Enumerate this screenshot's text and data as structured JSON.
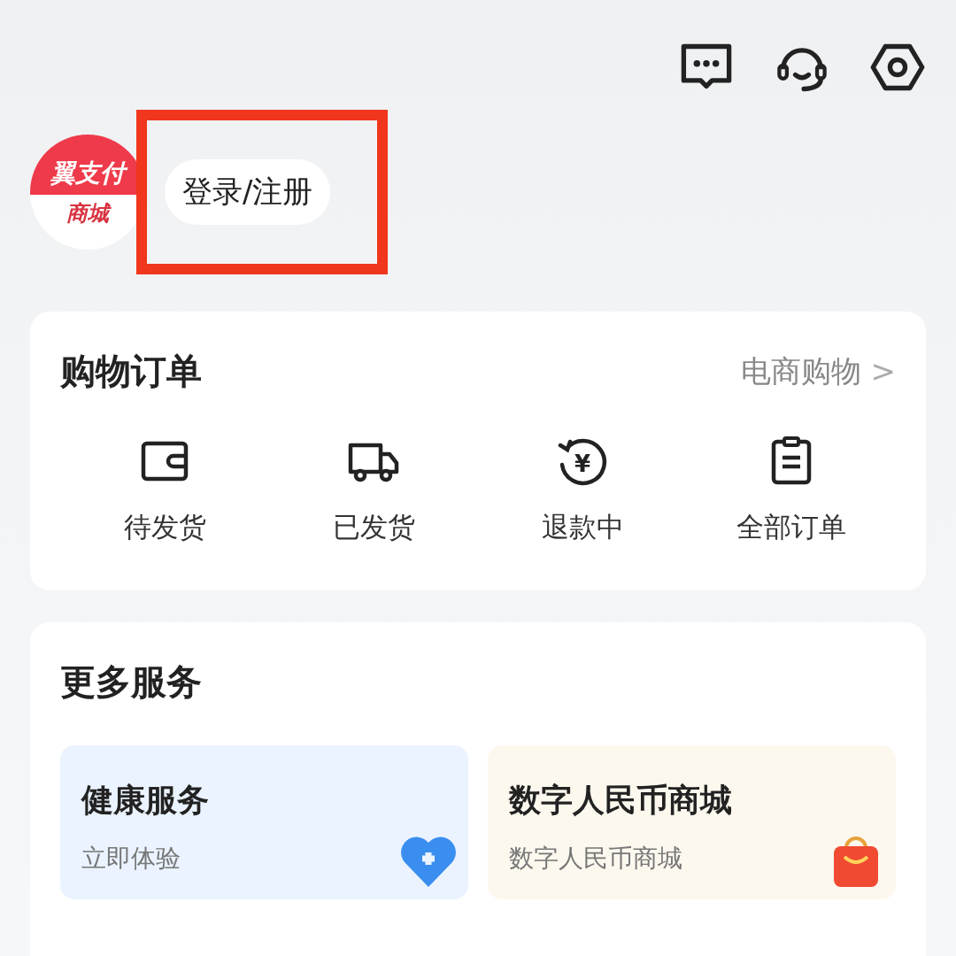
{
  "header": {
    "logo": {
      "top": "翼支付",
      "bottom": "商城"
    },
    "login_button": "登录/注册",
    "highlighted": true
  },
  "orders": {
    "title": "购物订单",
    "link": "电商购物",
    "link_arrow": ">",
    "items": [
      {
        "kind": "wallet",
        "label": "待发货"
      },
      {
        "kind": "truck",
        "label": "已发货"
      },
      {
        "kind": "refund",
        "label": "退款中",
        "glyph": "¥"
      },
      {
        "kind": "list",
        "label": "全部订单"
      }
    ]
  },
  "services": {
    "title": "更多服务",
    "cards": [
      {
        "kind": "health",
        "title": "健康服务",
        "subtitle": "立即体验"
      },
      {
        "kind": "shop",
        "title": "数字人民币商城",
        "subtitle": "数字人民币商城"
      }
    ]
  }
}
